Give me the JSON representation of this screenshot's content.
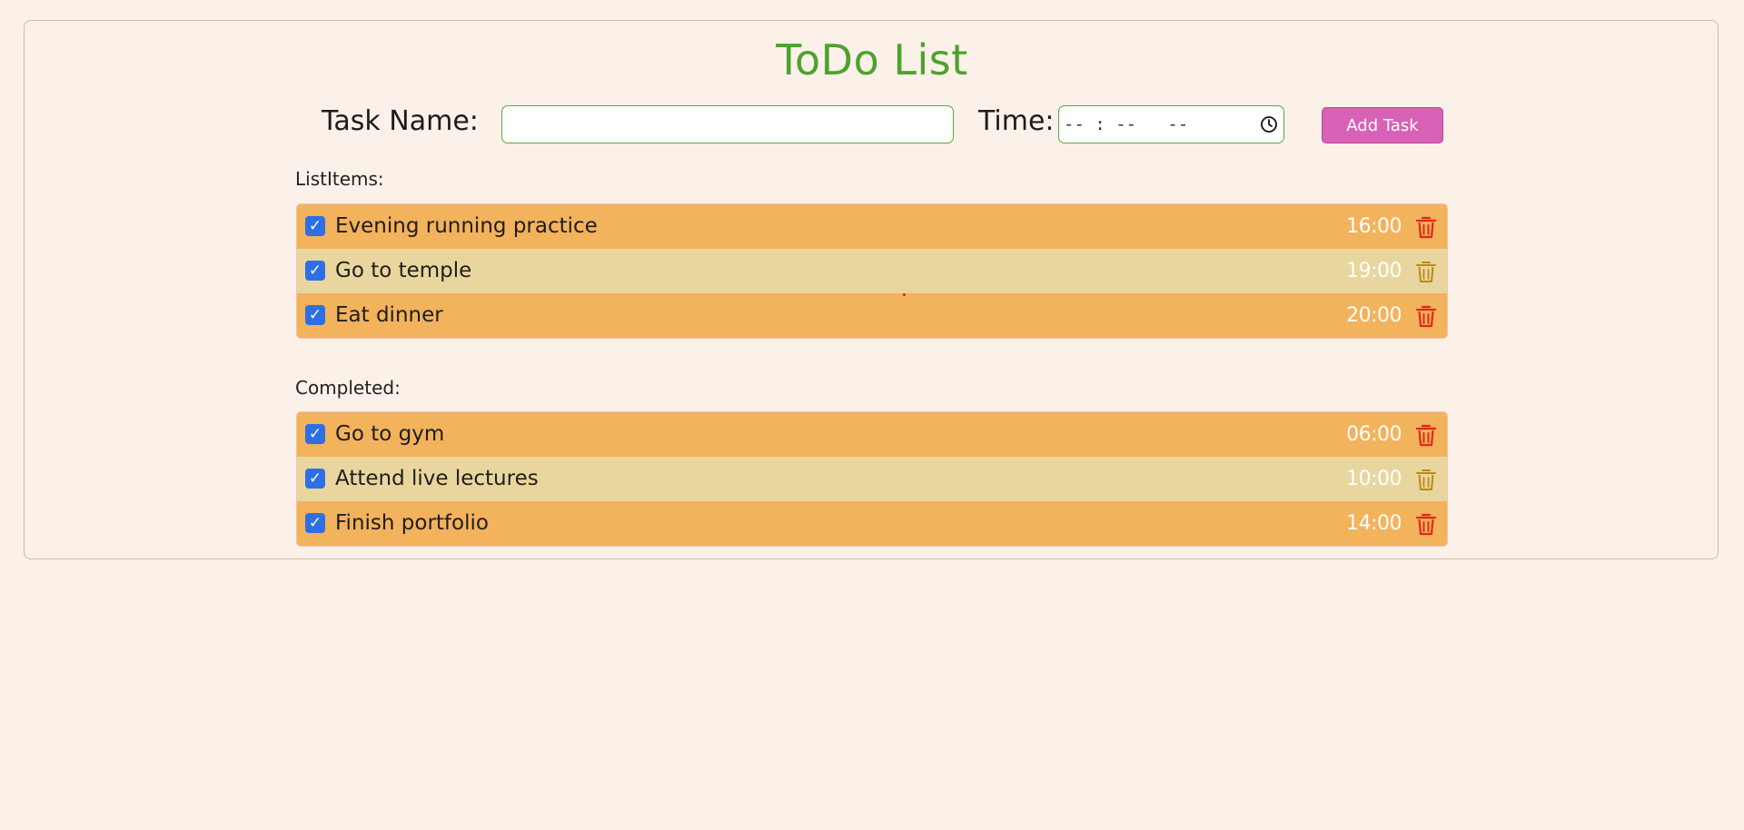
{
  "app": {
    "title": "ToDo List"
  },
  "form": {
    "task_label": "Task Name:",
    "task_value": "",
    "time_label": "Time:",
    "time_placeholder": "-- : --   --",
    "add_button": "Add Task"
  },
  "list_items": {
    "label": "ListItems:",
    "items": [
      {
        "name": "Evening running practice",
        "time": "16:00",
        "checked": true
      },
      {
        "name": "Go to temple",
        "time": "19:00",
        "checked": true
      },
      {
        "name": "Eat dinner",
        "time": "20:00",
        "checked": true
      }
    ]
  },
  "completed": {
    "label": "Completed:",
    "items": [
      {
        "name": "Go to gym",
        "time": "06:00",
        "checked": true
      },
      {
        "name": "Attend live lectures",
        "time": "10:00",
        "checked": true
      },
      {
        "name": "Finish portfolio",
        "time": "14:00",
        "checked": true
      }
    ]
  },
  "colors": {
    "title": "#4ea22d",
    "row_dark": "#f3b25c",
    "row_light": "#e9d69e",
    "add_button": "#d761b5",
    "checkbox": "#2f6fe6",
    "trash_dark_row": "#e0281a",
    "trash_light_row": "#b88a1e"
  },
  "icons": {
    "clock": "clock-icon",
    "trash": "trash-icon",
    "checkbox": "checkbox-checked"
  }
}
